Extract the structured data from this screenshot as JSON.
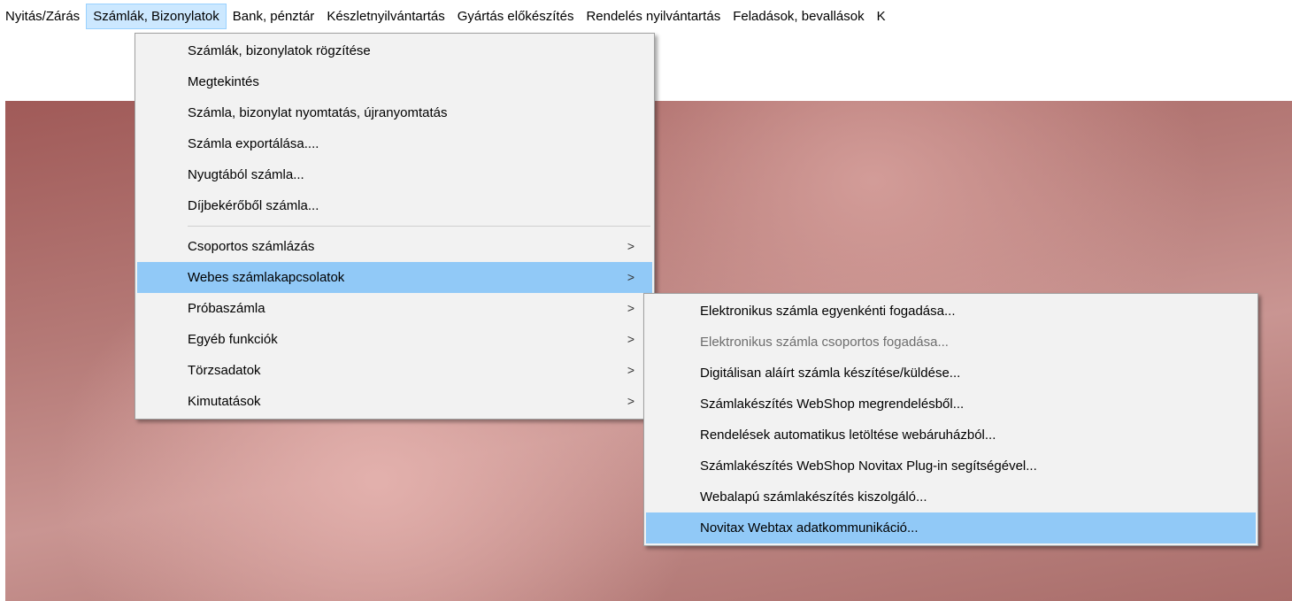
{
  "menubar": {
    "items": [
      "Nyitás/Zárás",
      "Számlák, Bizonylatok",
      "Bank, pénztár",
      "Készletnyilvántartás",
      "Gyártás előkészítés",
      "Rendelés nyilvántartás",
      "Feladások, bevallások",
      "K"
    ]
  },
  "invoices_menu": {
    "group1": [
      "Számlák, bizonylatok rögzítése",
      "Megtekintés",
      "Számla, bizonylat nyomtatás, újranyomtatás",
      "Számla exportálása....",
      "Nyugtából számla...",
      "Díjbekérőből számla..."
    ],
    "group2": [
      "Csoportos számlázás",
      "Webes számlakapcsolatok",
      "Próbaszámla",
      "Egyéb funkciók",
      "Törzsadatok",
      "Kimutatások"
    ],
    "submenu_arrow": ">"
  },
  "web_submenu": {
    "items": [
      "Elektronikus számla egyenkénti fogadása...",
      "Elektronikus számla csoportos fogadása...",
      "Digitálisan aláírt számla készítése/küldése...",
      "Számlakészítés WebShop megrendelésből...",
      "Rendelések automatikus letöltése webáruházból...",
      "Számlakészítés WebShop Novitax Plug-in segítségével...",
      "Webalapú számlakészítés kiszolgáló...",
      "Novitax Webtax adatkommunikáció..."
    ]
  }
}
